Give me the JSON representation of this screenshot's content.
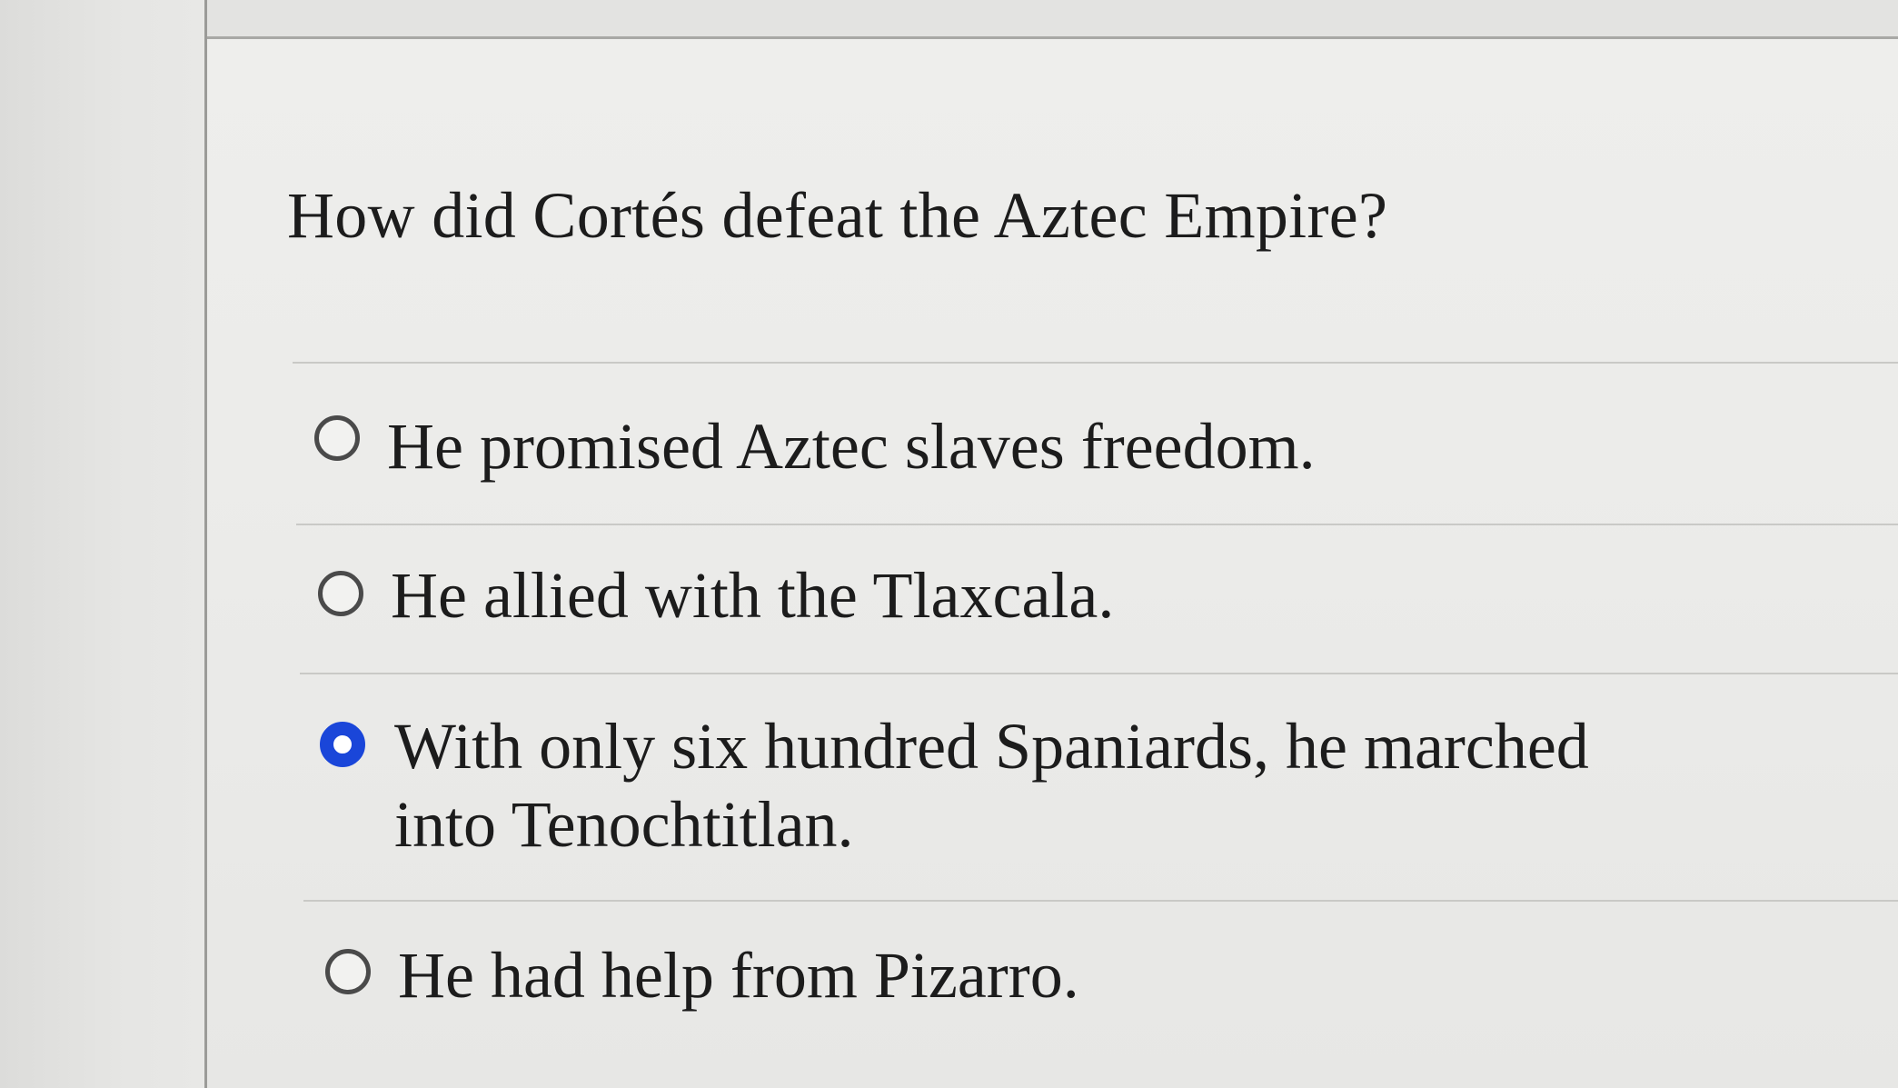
{
  "question": {
    "text": "How did Cortés defeat the Aztec Empire?"
  },
  "options": [
    {
      "label": "He promised Aztec slaves freedom.",
      "selected": false
    },
    {
      "label": "He allied with the Tlaxcala.",
      "selected": false
    },
    {
      "label": "With only six hundred Spaniards, he marched into Tenochtitlan.",
      "selected": true
    },
    {
      "label": "He had help from Pizarro.",
      "selected": false
    }
  ],
  "colors": {
    "selected_radio": "#1a46d9",
    "text": "#1c1c1c"
  }
}
